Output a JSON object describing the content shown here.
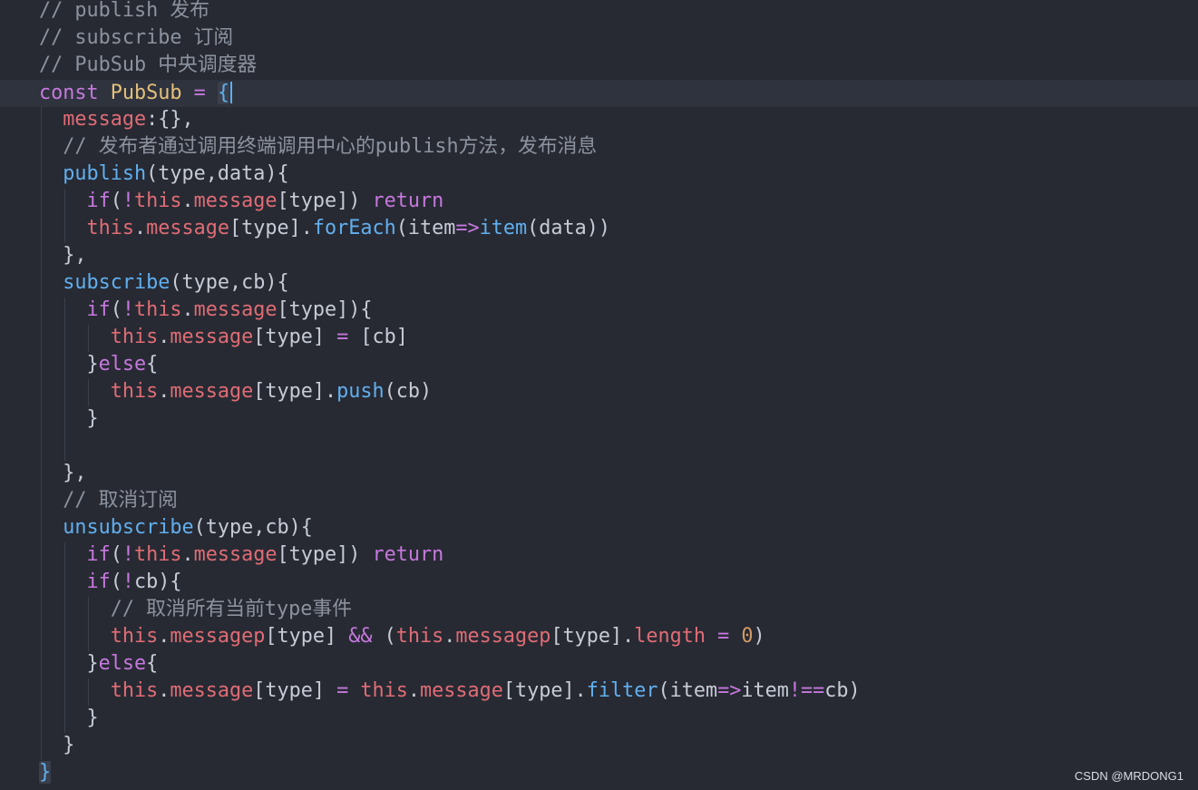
{
  "editor": {
    "lines": [
      [
        {
          "t": "// publish 发布",
          "c": "comment"
        }
      ],
      [
        {
          "t": "// subscribe 订阅",
          "c": "comment"
        }
      ],
      [
        {
          "t": "// PubSub 中央调度器",
          "c": "comment"
        }
      ],
      [
        {
          "t": "const ",
          "c": "keyword"
        },
        {
          "t": "PubSub",
          "c": "class"
        },
        {
          "t": " ",
          "c": "plain"
        },
        {
          "t": "=",
          "c": "op"
        },
        {
          "t": " ",
          "c": "plain"
        },
        {
          "t": "{",
          "c": "bracket-hl"
        },
        {
          "t": "",
          "c": "caret"
        }
      ],
      [
        {
          "t": "  ",
          "c": "plain"
        },
        {
          "t": "message",
          "c": "prop"
        },
        {
          "t": ":{},",
          "c": "punct"
        }
      ],
      [
        {
          "t": "  ",
          "c": "plain"
        },
        {
          "t": "// 发布者通过调用终端调用中心的publish方法，发布消息",
          "c": "comment"
        }
      ],
      [
        {
          "t": "  ",
          "c": "plain"
        },
        {
          "t": "publish",
          "c": "func"
        },
        {
          "t": "(type,data){",
          "c": "plain"
        }
      ],
      [
        {
          "t": "    ",
          "c": "plain"
        },
        {
          "t": "if",
          "c": "keyword"
        },
        {
          "t": "(",
          "c": "plain"
        },
        {
          "t": "!",
          "c": "op"
        },
        {
          "t": "this",
          "c": "prop"
        },
        {
          "t": ".",
          "c": "plain"
        },
        {
          "t": "message",
          "c": "prop"
        },
        {
          "t": "[type]) ",
          "c": "plain"
        },
        {
          "t": "return",
          "c": "keyword"
        }
      ],
      [
        {
          "t": "    ",
          "c": "plain"
        },
        {
          "t": "this",
          "c": "prop"
        },
        {
          "t": ".",
          "c": "plain"
        },
        {
          "t": "message",
          "c": "prop"
        },
        {
          "t": "[type].",
          "c": "plain"
        },
        {
          "t": "forEach",
          "c": "func"
        },
        {
          "t": "(item",
          "c": "plain"
        },
        {
          "t": "=>",
          "c": "op"
        },
        {
          "t": "item",
          "c": "func"
        },
        {
          "t": "(data))",
          "c": "plain"
        }
      ],
      [
        {
          "t": "  },",
          "c": "plain"
        }
      ],
      [
        {
          "t": "  ",
          "c": "plain"
        },
        {
          "t": "subscribe",
          "c": "func"
        },
        {
          "t": "(type,cb){",
          "c": "plain"
        }
      ],
      [
        {
          "t": "    ",
          "c": "plain"
        },
        {
          "t": "if",
          "c": "keyword"
        },
        {
          "t": "(",
          "c": "plain"
        },
        {
          "t": "!",
          "c": "op"
        },
        {
          "t": "this",
          "c": "prop"
        },
        {
          "t": ".",
          "c": "plain"
        },
        {
          "t": "message",
          "c": "prop"
        },
        {
          "t": "[type]){",
          "c": "plain"
        }
      ],
      [
        {
          "t": "      ",
          "c": "plain"
        },
        {
          "t": "this",
          "c": "prop"
        },
        {
          "t": ".",
          "c": "plain"
        },
        {
          "t": "message",
          "c": "prop"
        },
        {
          "t": "[type] ",
          "c": "plain"
        },
        {
          "t": "=",
          "c": "op"
        },
        {
          "t": " [cb]",
          "c": "plain"
        }
      ],
      [
        {
          "t": "    }",
          "c": "plain"
        },
        {
          "t": "else",
          "c": "keyword"
        },
        {
          "t": "{",
          "c": "plain"
        }
      ],
      [
        {
          "t": "      ",
          "c": "plain"
        },
        {
          "t": "this",
          "c": "prop"
        },
        {
          "t": ".",
          "c": "plain"
        },
        {
          "t": "message",
          "c": "prop"
        },
        {
          "t": "[type].",
          "c": "plain"
        },
        {
          "t": "push",
          "c": "func"
        },
        {
          "t": "(cb)",
          "c": "plain"
        }
      ],
      [
        {
          "t": "    }",
          "c": "plain"
        }
      ],
      [
        {
          "t": "",
          "c": "plain"
        }
      ],
      [
        {
          "t": "  },",
          "c": "plain"
        }
      ],
      [
        {
          "t": "  ",
          "c": "plain"
        },
        {
          "t": "// 取消订阅",
          "c": "comment"
        }
      ],
      [
        {
          "t": "  ",
          "c": "plain"
        },
        {
          "t": "unsubscribe",
          "c": "func"
        },
        {
          "t": "(type,cb){",
          "c": "plain"
        }
      ],
      [
        {
          "t": "    ",
          "c": "plain"
        },
        {
          "t": "if",
          "c": "keyword"
        },
        {
          "t": "(",
          "c": "plain"
        },
        {
          "t": "!",
          "c": "op"
        },
        {
          "t": "this",
          "c": "prop"
        },
        {
          "t": ".",
          "c": "plain"
        },
        {
          "t": "message",
          "c": "prop"
        },
        {
          "t": "[type]) ",
          "c": "plain"
        },
        {
          "t": "return",
          "c": "keyword"
        }
      ],
      [
        {
          "t": "    ",
          "c": "plain"
        },
        {
          "t": "if",
          "c": "keyword"
        },
        {
          "t": "(",
          "c": "plain"
        },
        {
          "t": "!",
          "c": "op"
        },
        {
          "t": "cb){",
          "c": "plain"
        }
      ],
      [
        {
          "t": "      ",
          "c": "plain"
        },
        {
          "t": "// 取消所有当前type事件",
          "c": "comment"
        }
      ],
      [
        {
          "t": "      ",
          "c": "plain"
        },
        {
          "t": "this",
          "c": "prop"
        },
        {
          "t": ".",
          "c": "plain"
        },
        {
          "t": "messagep",
          "c": "prop"
        },
        {
          "t": "[type] ",
          "c": "plain"
        },
        {
          "t": "&&",
          "c": "op"
        },
        {
          "t": " (",
          "c": "plain"
        },
        {
          "t": "this",
          "c": "prop"
        },
        {
          "t": ".",
          "c": "plain"
        },
        {
          "t": "messagep",
          "c": "prop"
        },
        {
          "t": "[type].",
          "c": "plain"
        },
        {
          "t": "length",
          "c": "prop"
        },
        {
          "t": " ",
          "c": "plain"
        },
        {
          "t": "=",
          "c": "op"
        },
        {
          "t": " ",
          "c": "plain"
        },
        {
          "t": "0",
          "c": "number"
        },
        {
          "t": ")",
          "c": "plain"
        }
      ],
      [
        {
          "t": "    }",
          "c": "plain"
        },
        {
          "t": "else",
          "c": "keyword"
        },
        {
          "t": "{",
          "c": "plain"
        }
      ],
      [
        {
          "t": "      ",
          "c": "plain"
        },
        {
          "t": "this",
          "c": "prop"
        },
        {
          "t": ".",
          "c": "plain"
        },
        {
          "t": "message",
          "c": "prop"
        },
        {
          "t": "[type] ",
          "c": "plain"
        },
        {
          "t": "=",
          "c": "op"
        },
        {
          "t": " ",
          "c": "plain"
        },
        {
          "t": "this",
          "c": "prop"
        },
        {
          "t": ".",
          "c": "plain"
        },
        {
          "t": "message",
          "c": "prop"
        },
        {
          "t": "[type].",
          "c": "plain"
        },
        {
          "t": "filter",
          "c": "func"
        },
        {
          "t": "(item",
          "c": "plain"
        },
        {
          "t": "=>",
          "c": "op"
        },
        {
          "t": "item",
          "c": "plain"
        },
        {
          "t": "!==",
          "c": "op"
        },
        {
          "t": "cb)",
          "c": "plain"
        }
      ],
      [
        {
          "t": "    }",
          "c": "plain"
        }
      ],
      [
        {
          "t": "  }",
          "c": "plain"
        }
      ],
      [
        {
          "t": "}",
          "c": "bracket-hl"
        }
      ]
    ]
  },
  "watermark": {
    "text": "CSDN @MRDONG1"
  },
  "colors": {
    "background": "#272a33",
    "current_line": "#2f333e",
    "comment": "#8c929e",
    "keyword": "#c678dd",
    "function": "#61afef",
    "property": "#e06c75",
    "class": "#e5c07b",
    "number": "#d19a66",
    "text": "#c6cbd5"
  }
}
